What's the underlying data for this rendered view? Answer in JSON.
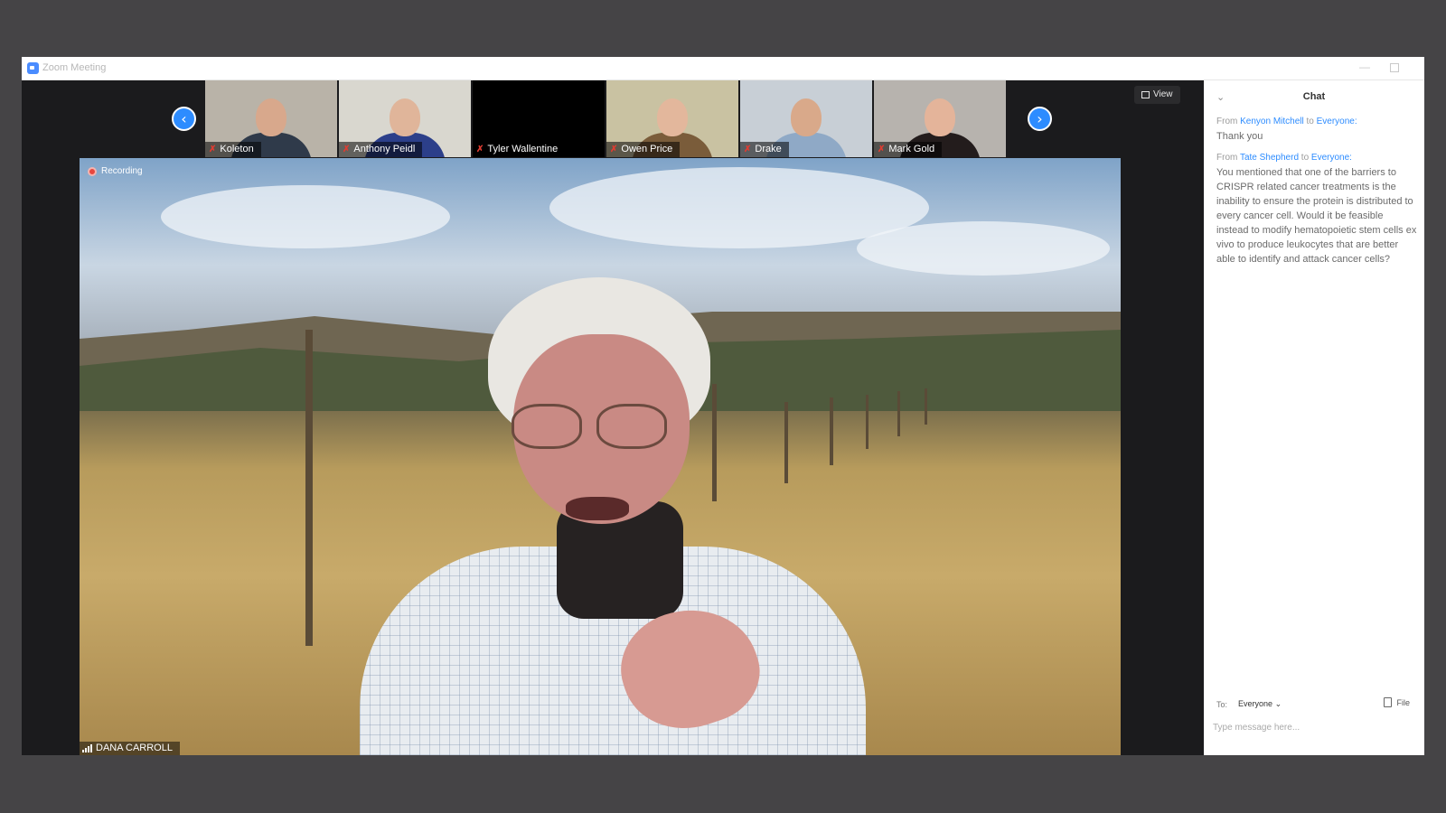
{
  "window": {
    "title": "Zoom Meeting"
  },
  "gallery": {
    "prev_icon": "chevron-left-icon",
    "next_icon": "chevron-right-icon",
    "view_label": "View",
    "participants": [
      {
        "name": "Koleton",
        "muted": true,
        "bg": "#b9b3a8",
        "shirt": "#2f3a4a",
        "skin": "#d8a88c"
      },
      {
        "name": "Anthony Peidl",
        "muted": true,
        "bg": "#d9d7cf",
        "shirt": "#2c3f8a",
        "skin": "#e0b59a"
      },
      {
        "name": "Tyler Wallentine",
        "muted": true,
        "bg": "#000000",
        "shirt": "#000000",
        "skin": "#000000"
      },
      {
        "name": "Owen Price",
        "muted": true,
        "bg": "#c9c2a2",
        "shirt": "#7a5c3a",
        "skin": "#e3b79c"
      },
      {
        "name": "Drake",
        "muted": true,
        "bg": "#c8cfd6",
        "shirt": "#8fa9c6",
        "skin": "#d9a98a"
      },
      {
        "name": "Mark Gold",
        "muted": true,
        "bg": "#b7b3ae",
        "shirt": "#231c1c",
        "skin": "#e4b49a"
      }
    ]
  },
  "speaker": {
    "recording_label": "Recording",
    "name": "DANA CARROLL"
  },
  "chat": {
    "title": "Chat",
    "messages": [
      {
        "from_prefix": "From",
        "sender": "Kenyon Mitchell",
        "to_word": "to",
        "recipient": "Everyone:",
        "text": "Thank you"
      },
      {
        "from_prefix": "From",
        "sender": "Tate Shepherd",
        "to_word": "to",
        "recipient": "Everyone:",
        "text": "You mentioned that one of the barriers to CRISPR related cancer treatments is the inability to ensure the protein is distributed to every cancer cell. Would it be feasible instead to modify hematopoietic stem cells ex vivo to produce leukocytes that are better able to identify and attack cancer cells?"
      }
    ],
    "to_label": "To:",
    "to_value": "Everyone",
    "file_label": "File",
    "input_placeholder": "Type message here..."
  },
  "colors": {
    "accent": "#2d8cff",
    "recording": "#e8473f",
    "muted_mic": "#e03c31"
  }
}
